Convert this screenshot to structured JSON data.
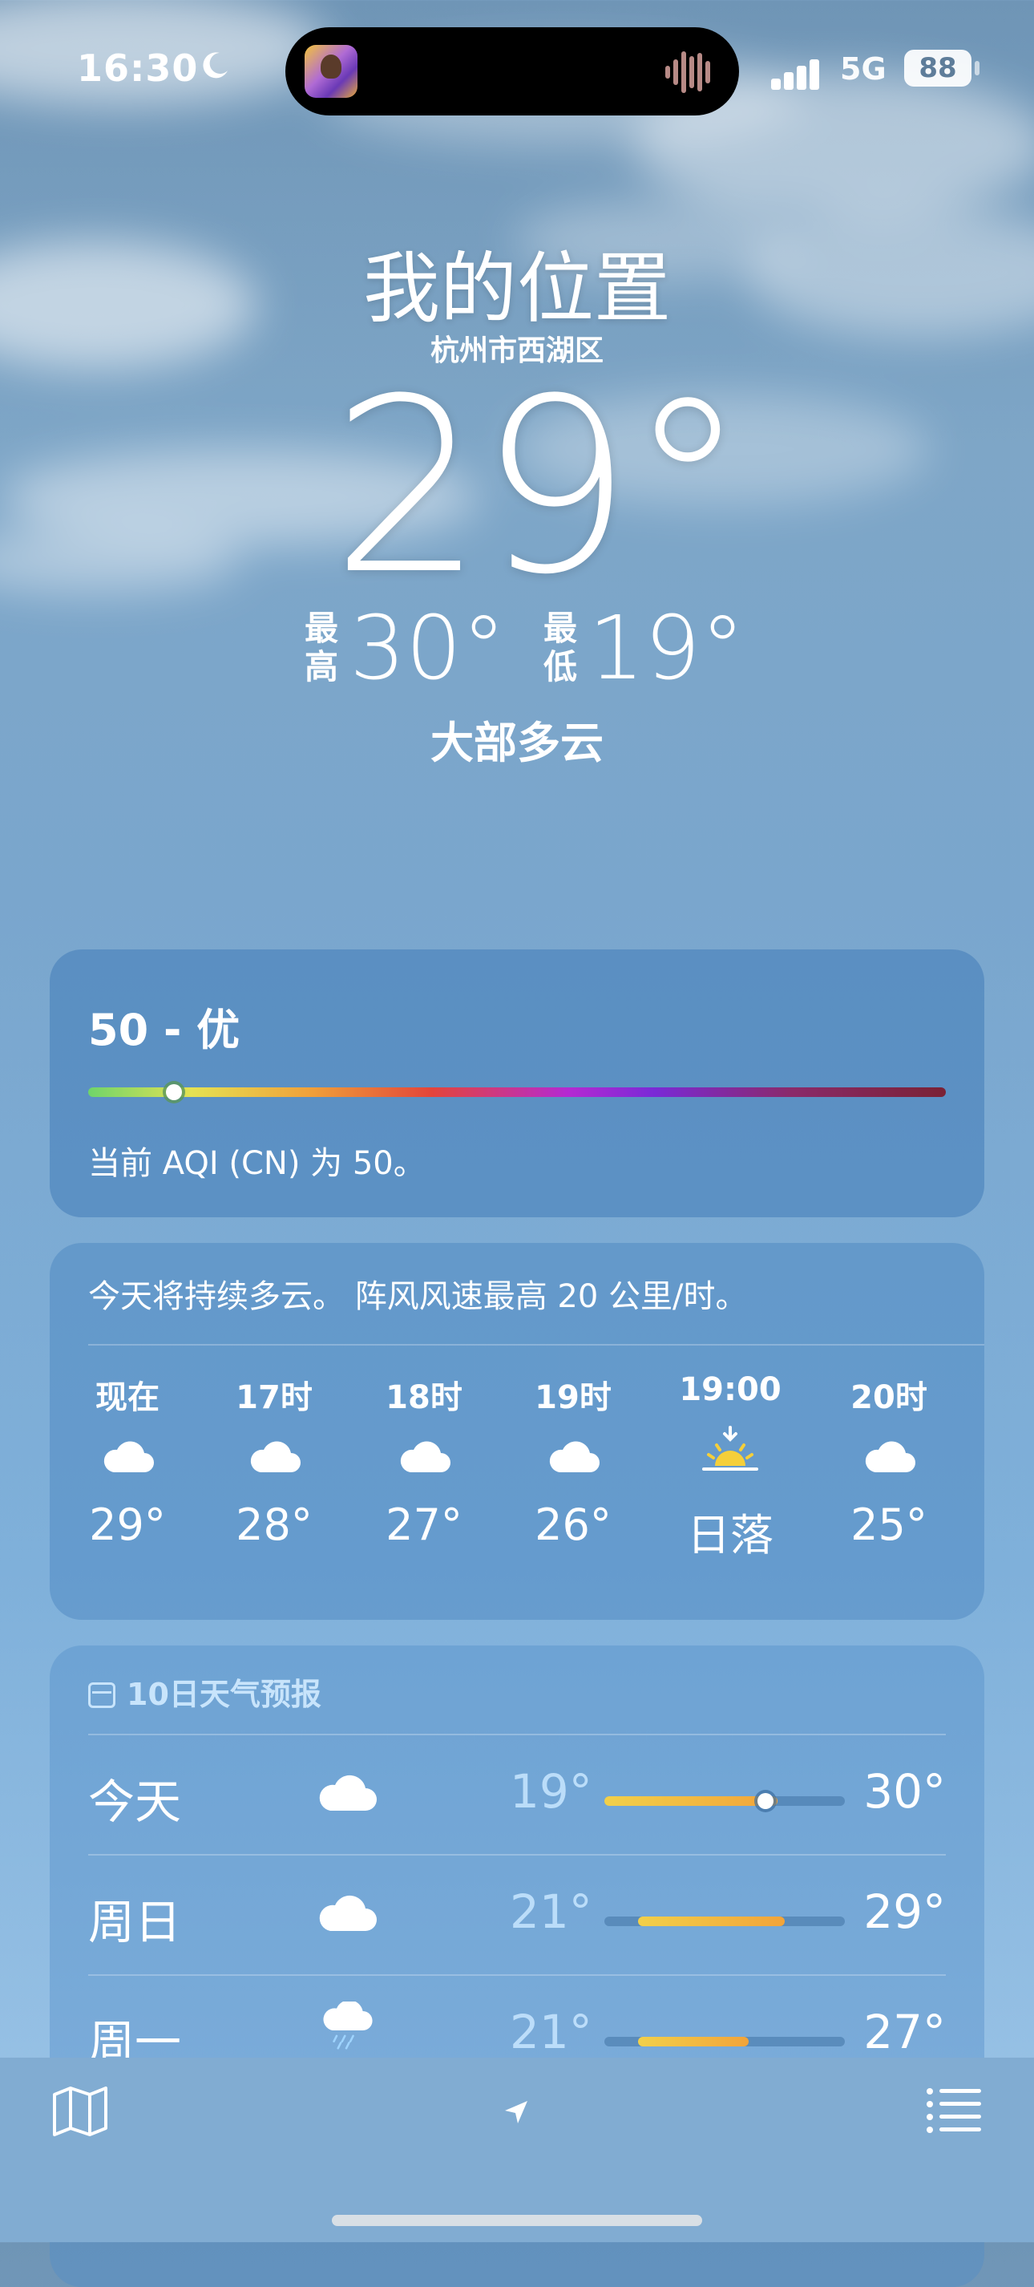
{
  "status": {
    "time": "16:30",
    "network": "5G",
    "battery": "88"
  },
  "header": {
    "title": "我的位置",
    "subtitle": "杭州市西湖区",
    "temperature": "29°",
    "high_label": "最高",
    "high": "30°",
    "low_label": "最低",
    "low": "19°",
    "condition": "大部多云"
  },
  "aqi": {
    "label": "50 - 优",
    "description": "当前 AQI (CN) 为 50。",
    "value_fraction": 0.1
  },
  "hourly": {
    "summary": "今天将持续多云。 阵风风速最高 20 公里/时。",
    "items": [
      {
        "hour": "现在",
        "icon": "cloud-icon",
        "temp": "29°"
      },
      {
        "hour": "17时",
        "icon": "cloud-icon",
        "temp": "28°"
      },
      {
        "hour": "18时",
        "icon": "cloud-icon",
        "temp": "27°"
      },
      {
        "hour": "19时",
        "icon": "cloud-icon",
        "temp": "26°"
      },
      {
        "hour": "19:00",
        "icon": "sunset-icon",
        "temp": "日落"
      },
      {
        "hour": "20时",
        "icon": "cloud-icon",
        "temp": "25°"
      }
    ]
  },
  "daily": {
    "header": "10日天气预报",
    "days": [
      {
        "name": "今天",
        "icon": "cloud-icon",
        "low": "19°",
        "high": "30°",
        "range_start": 0.0,
        "range_end": 0.72,
        "current": 0.67
      },
      {
        "name": "周日",
        "icon": "cloud-icon",
        "low": "21°",
        "high": "29°",
        "range_start": 0.14,
        "range_end": 0.75
      },
      {
        "name": "周一",
        "icon": "rain-icon",
        "low": "21°",
        "high": "27°",
        "range_start": 0.14,
        "range_end": 0.6
      }
    ]
  },
  "colors": {
    "accent_temp_bar": "#f2a43a",
    "aqi_good": "#6fd46a"
  }
}
